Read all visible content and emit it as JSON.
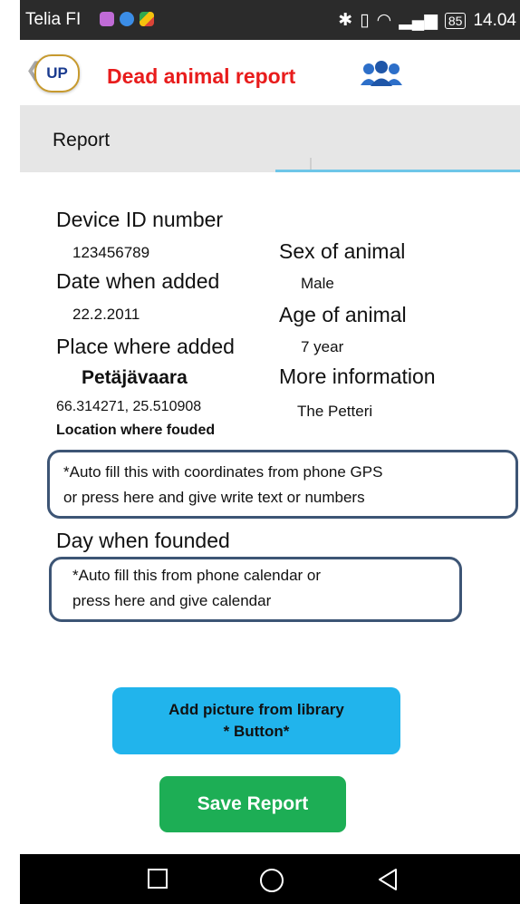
{
  "status_bar": {
    "carrier": "Telia FI",
    "battery": "85",
    "time": "14.04",
    "icons": [
      "gallery-icon",
      "download-icon",
      "maps-icon",
      "bluetooth-icon",
      "vibrate-icon",
      "wifi-icon",
      "signal-icon"
    ]
  },
  "app_bar": {
    "logo_text": "UP",
    "title": "Dead animal report",
    "title_color": "#e81c1c"
  },
  "tabs": {
    "active_label": "Report"
  },
  "details": {
    "device_id_label": "Device ID number",
    "device_id_value": "123456789",
    "date_added_label": "Date when added",
    "date_added_value": "22.2.2011",
    "place_added_label": "Place where added",
    "place_name": "Petäjävaara",
    "place_coords": "66.314271, 25.510908",
    "sex_label": "Sex of animal",
    "sex_value": "Male",
    "age_label": "Age of animal",
    "age_value": "7 year",
    "more_info_label": "More information",
    "more_info_value": "The Petteri"
  },
  "location_found": {
    "label": "Location where fouded",
    "hint_line1": "*Auto fill this with coordinates from phone GPS",
    "hint_line2": "or press here and give write text or numbers"
  },
  "day_found": {
    "label": "Day when founded",
    "hint_line1": "*Auto fill this from phone calendar or",
    "hint_line2": "press here and give calendar"
  },
  "buttons": {
    "add_picture_line1": "Add picture from library",
    "add_picture_line2": "* Button*",
    "add_picture_color": "#21b4ec",
    "save_label": "Save Report",
    "save_color": "#1dae55"
  }
}
